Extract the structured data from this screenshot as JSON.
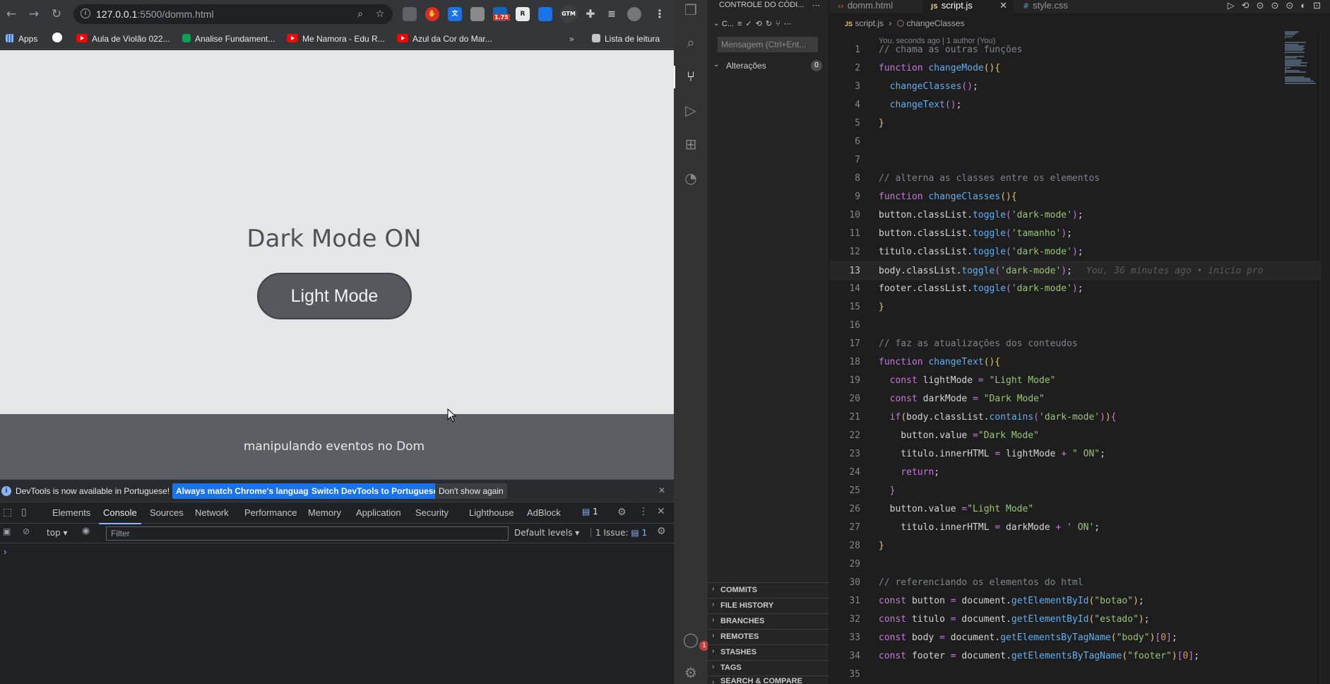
{
  "browser": {
    "url_host": "127.0.0.1",
    "url_rest": ":5500/domm.html",
    "bookmarks": [
      {
        "label": "Apps",
        "icon": "apps-grid-icon"
      },
      {
        "label": "",
        "icon": "google-icon"
      },
      {
        "label": "Aula de Violão 022...",
        "icon": "youtube-icon"
      },
      {
        "label": "Analise Fundament...",
        "icon": "chart-icon"
      },
      {
        "label": "Me Namora - Edu R...",
        "icon": "youtube-icon"
      },
      {
        "label": "Azul da Cor do Mar...",
        "icon": "youtube-icon"
      }
    ],
    "reading_list": "Lista de leitura",
    "extension_badge": "1.75",
    "gtm_label": "GTM"
  },
  "page": {
    "title": "Dark Mode ON",
    "button_label": "Light Mode",
    "footer_text": "manipulando eventos no Dom"
  },
  "devtools": {
    "banner": "DevTools is now available in Portuguese!",
    "btn_match": "Always match Chrome's language",
    "btn_switch": "Switch DevTools to Portuguese",
    "btn_dismiss": "Don't show again",
    "tabs": [
      "Elements",
      "Console",
      "Sources",
      "Network",
      "Performance",
      "Memory",
      "Application",
      "Security",
      "Lighthouse",
      "AdBlock"
    ],
    "active_tab": "Console",
    "issues_count": "1",
    "context": "top",
    "filter_placeholder": "Filter",
    "levels": "Default levels",
    "issue_label": "1 Issue:",
    "issue_num": "1",
    "prompt": "›"
  },
  "vscode": {
    "sidebar_title": "CONTROLE DO CÓDI...",
    "sidebar_row": "C...",
    "message_placeholder": "Mensagem (Ctrl+Ent...",
    "changes_label": "Alterações",
    "changes_count": "0",
    "sections": [
      "COMMITS",
      "FILE HISTORY",
      "BRANCHES",
      "REMOTES",
      "STASHES",
      "TAGS",
      "SEARCH & COMPARE"
    ],
    "tabs": [
      {
        "label": "domm.html",
        "icon": "html-file-icon"
      },
      {
        "label": "script.js",
        "icon": "js-file-icon"
      },
      {
        "label": "style.css",
        "icon": "css-file-icon"
      }
    ],
    "active_tab": "script.js",
    "breadcrumb_file": "script.js",
    "breadcrumb_symbol": "changeClasses",
    "blame_header": "You, seconds ago | 1 author (You)",
    "blame_inline": "You, 36 minutes ago • inicio pro",
    "account_badge": "1"
  },
  "code": [
    {
      "n": "1",
      "t": [
        [
          "c-comment",
          "// chama as outras funções"
        ]
      ]
    },
    {
      "n": "2",
      "t": [
        [
          "c-kw",
          "function "
        ],
        [
          "c-fn",
          "changeMode"
        ],
        [
          "c-var",
          "(){"
        ]
      ]
    },
    {
      "n": "3",
      "t": [
        [
          "",
          "  "
        ],
        [
          "c-fn",
          "changeClasses"
        ],
        [
          "c-kw",
          "()"
        ],
        [
          "",
          ";"
        ]
      ]
    },
    {
      "n": "4",
      "t": [
        [
          "",
          "  "
        ],
        [
          "c-fn",
          "changeText"
        ],
        [
          "c-kw",
          "()"
        ],
        [
          "",
          ";"
        ]
      ]
    },
    {
      "n": "5",
      "t": [
        [
          "c-var",
          "}"
        ]
      ]
    },
    {
      "n": "6",
      "t": []
    },
    {
      "n": "7",
      "t": []
    },
    {
      "n": "8",
      "t": [
        [
          "c-comment",
          "// alterna as classes entre os elementos"
        ]
      ]
    },
    {
      "n": "9",
      "t": [
        [
          "c-kw",
          "function "
        ],
        [
          "c-fn",
          "changeClasses"
        ],
        [
          "c-var",
          "(){"
        ]
      ]
    },
    {
      "n": "10",
      "t": [
        [
          "",
          "button.classList."
        ],
        [
          "c-fn",
          "toggle"
        ],
        [
          "c-kw",
          "("
        ],
        [
          "c-str",
          "'dark-mode'"
        ],
        [
          "c-kw",
          ")"
        ],
        [
          "",
          ";"
        ]
      ]
    },
    {
      "n": "11",
      "t": [
        [
          "",
          "button.classList."
        ],
        [
          "c-fn",
          "toggle"
        ],
        [
          "c-kw",
          "("
        ],
        [
          "c-str",
          "'tamanho'"
        ],
        [
          "c-kw",
          ")"
        ],
        [
          "",
          ";"
        ]
      ]
    },
    {
      "n": "12",
      "t": [
        [
          "",
          "titulo.classList."
        ],
        [
          "c-fn",
          "toggle"
        ],
        [
          "c-kw",
          "("
        ],
        [
          "c-str",
          "'dark-mode'"
        ],
        [
          "c-kw",
          ")"
        ],
        [
          "",
          ";"
        ]
      ]
    },
    {
      "n": "13",
      "t": [
        [
          "",
          "body.classList."
        ],
        [
          "c-fn",
          "toggle"
        ],
        [
          "c-kw",
          "("
        ],
        [
          "c-str",
          "'dark-mode'"
        ],
        [
          "c-kw",
          ")"
        ],
        [
          "",
          ";"
        ]
      ],
      "current": true
    },
    {
      "n": "14",
      "t": [
        [
          "",
          "footer.classList."
        ],
        [
          "c-fn",
          "toggle"
        ],
        [
          "c-kw",
          "("
        ],
        [
          "c-str",
          "'dark-mode'"
        ],
        [
          "c-kw",
          ")"
        ],
        [
          "",
          ";"
        ]
      ]
    },
    {
      "n": "15",
      "t": [
        [
          "c-var",
          "}"
        ]
      ]
    },
    {
      "n": "16",
      "t": []
    },
    {
      "n": "17",
      "t": [
        [
          "c-comment",
          "// faz as atualizações dos conteudos"
        ]
      ]
    },
    {
      "n": "18",
      "t": [
        [
          "c-kw",
          "function "
        ],
        [
          "c-fn",
          "changeText"
        ],
        [
          "c-var",
          "(){"
        ]
      ]
    },
    {
      "n": "19",
      "t": [
        [
          "",
          "  "
        ],
        [
          "c-kw",
          "const "
        ],
        [
          "",
          "lightMode "
        ],
        [
          "c-kw",
          "= "
        ],
        [
          "c-str",
          "\"Light Mode\""
        ]
      ]
    },
    {
      "n": "20",
      "t": [
        [
          "",
          "  "
        ],
        [
          "c-kw",
          "const "
        ],
        [
          "",
          "darkMode "
        ],
        [
          "c-kw",
          "= "
        ],
        [
          "c-str",
          "\"Dark Mode\""
        ]
      ]
    },
    {
      "n": "21",
      "t": [
        [
          "",
          "  "
        ],
        [
          "c-kw",
          "if"
        ],
        [
          "c-var",
          "("
        ],
        [
          "",
          "body.classList."
        ],
        [
          "c-fn",
          "contains"
        ],
        [
          "c-kw",
          "("
        ],
        [
          "c-str",
          "'dark-mode'"
        ],
        [
          "c-kw",
          ")"
        ],
        [
          "c-var",
          ")"
        ],
        [
          "c-kw",
          "{"
        ]
      ]
    },
    {
      "n": "22",
      "t": [
        [
          "",
          "    button.value "
        ],
        [
          "c-kw",
          "="
        ],
        [
          "c-str",
          "\"Dark Mode\""
        ]
      ]
    },
    {
      "n": "23",
      "t": [
        [
          "",
          "    titulo.innerHTML "
        ],
        [
          "c-kw",
          "= "
        ],
        [
          "",
          "lightMode "
        ],
        [
          "c-kw",
          "+ "
        ],
        [
          "c-str",
          "\" ON\""
        ],
        [
          "",
          ";"
        ]
      ]
    },
    {
      "n": "24",
      "t": [
        [
          "",
          "    "
        ],
        [
          "c-kw",
          "return"
        ],
        [
          "",
          ";"
        ]
      ]
    },
    {
      "n": "25",
      "t": [
        [
          "",
          "  "
        ],
        [
          "c-kw",
          "}"
        ]
      ]
    },
    {
      "n": "26",
      "t": [
        [
          "",
          "  button.value "
        ],
        [
          "c-kw",
          "="
        ],
        [
          "c-str",
          "\"Light Mode\""
        ]
      ]
    },
    {
      "n": "27",
      "t": [
        [
          "",
          "    titulo.innerHTML "
        ],
        [
          "c-kw",
          "= "
        ],
        [
          "",
          "darkMode "
        ],
        [
          "c-kw",
          "+ "
        ],
        [
          "c-str",
          "' ON'"
        ],
        [
          "",
          ";"
        ]
      ]
    },
    {
      "n": "28",
      "t": [
        [
          "c-var",
          "}"
        ]
      ]
    },
    {
      "n": "29",
      "t": []
    },
    {
      "n": "30",
      "t": [
        [
          "c-comment",
          "// referenciando os elementos do html"
        ]
      ]
    },
    {
      "n": "31",
      "t": [
        [
          "c-kw",
          "const "
        ],
        [
          "",
          "button "
        ],
        [
          "c-kw",
          "= "
        ],
        [
          "",
          "document."
        ],
        [
          "c-fn",
          "getElementById"
        ],
        [
          "c-var",
          "("
        ],
        [
          "c-str",
          "\"botao\""
        ],
        [
          "c-var",
          ")"
        ],
        [
          "",
          ";"
        ]
      ]
    },
    {
      "n": "32",
      "t": [
        [
          "c-kw",
          "const "
        ],
        [
          "",
          "titulo "
        ],
        [
          "c-kw",
          "= "
        ],
        [
          "",
          "document."
        ],
        [
          "c-fn",
          "getElementById"
        ],
        [
          "c-var",
          "("
        ],
        [
          "c-str",
          "\"estado\""
        ],
        [
          "c-var",
          ")"
        ],
        [
          "",
          ";"
        ]
      ]
    },
    {
      "n": "33",
      "t": [
        [
          "c-kw",
          "const "
        ],
        [
          "",
          "body "
        ],
        [
          "c-kw",
          "= "
        ],
        [
          "",
          "document."
        ],
        [
          "c-fn",
          "getElementsByTagName"
        ],
        [
          "c-var",
          "("
        ],
        [
          "c-str",
          "\"body\""
        ],
        [
          "c-var",
          ")"
        ],
        [
          "c-kw",
          "["
        ],
        [
          "c-num",
          "0"
        ],
        [
          "c-kw",
          "]"
        ],
        [
          "",
          ";"
        ]
      ]
    },
    {
      "n": "34",
      "t": [
        [
          "c-kw",
          "const "
        ],
        [
          "",
          "footer "
        ],
        [
          "c-kw",
          "= "
        ],
        [
          "",
          "document."
        ],
        [
          "c-fn",
          "getElementsByTagName"
        ],
        [
          "c-var",
          "("
        ],
        [
          "c-str",
          "\"footer\""
        ],
        [
          "c-var",
          ")"
        ],
        [
          "c-kw",
          "["
        ],
        [
          "c-num",
          "0"
        ],
        [
          "c-kw",
          "]"
        ],
        [
          "",
          ";"
        ]
      ]
    },
    {
      "n": "35",
      "t": []
    }
  ]
}
